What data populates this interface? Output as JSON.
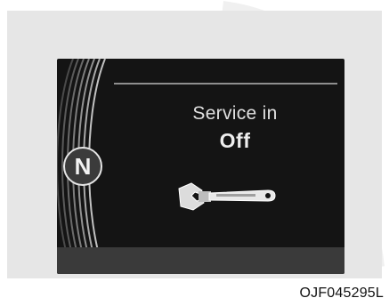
{
  "cluster": {
    "message_line1": "Service in",
    "message_line2": "Off",
    "gear_indicator": "N",
    "icon": "wrench-icon"
  },
  "caption": "OJF045295L",
  "colors": {
    "cluster_bg": "#141414",
    "frame_bg": "#e6e6e6",
    "text": "#e0e0e0"
  }
}
